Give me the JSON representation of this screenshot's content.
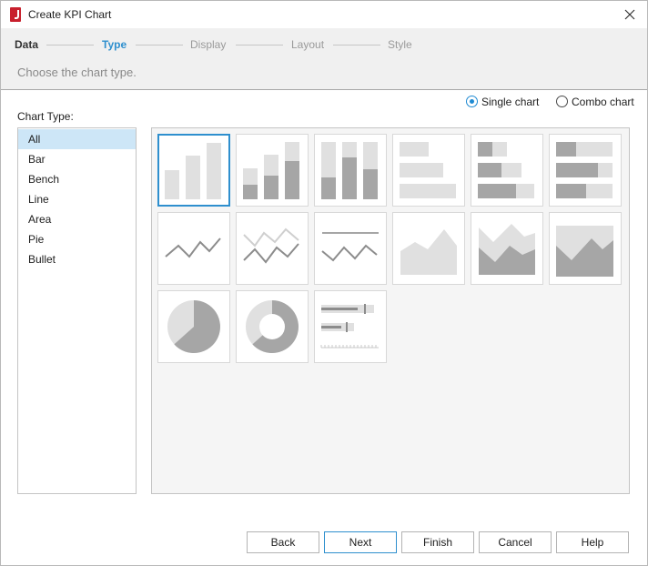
{
  "window": {
    "title": "Create KPI Chart",
    "close_icon": "close-icon"
  },
  "wizard": {
    "steps": [
      {
        "label": "Data",
        "state": "done"
      },
      {
        "label": "Type",
        "state": "active"
      },
      {
        "label": "Display",
        "state": "pending"
      },
      {
        "label": "Layout",
        "state": "pending"
      },
      {
        "label": "Style",
        "state": "pending"
      }
    ],
    "description": "Choose the chart type."
  },
  "mode": {
    "options": [
      "Single chart",
      "Combo chart"
    ],
    "selected": "Single chart"
  },
  "chart_types": {
    "label": "Chart Type:",
    "items": [
      "All",
      "Bar",
      "Bench",
      "Line",
      "Area",
      "Pie",
      "Bullet"
    ],
    "selected": "All"
  },
  "gallery": {
    "thumbnails": [
      {
        "icon": "bar-chart-icon",
        "selected": true
      },
      {
        "icon": "clustered-bar-chart-icon",
        "selected": false
      },
      {
        "icon": "stacked-bar-chart-icon",
        "selected": false
      },
      {
        "icon": "horizontal-bar-chart-icon",
        "selected": false
      },
      {
        "icon": "horizontal-bench-chart-icon",
        "selected": false
      },
      {
        "icon": "horizontal-stacked-bench-chart-icon",
        "selected": false
      },
      {
        "icon": "line-chart-icon",
        "selected": false
      },
      {
        "icon": "multi-line-chart-icon",
        "selected": false
      },
      {
        "icon": "line-with-target-chart-icon",
        "selected": false
      },
      {
        "icon": "area-chart-icon",
        "selected": false
      },
      {
        "icon": "overlapped-area-chart-icon",
        "selected": false
      },
      {
        "icon": "stacked-area-chart-icon",
        "selected": false
      },
      {
        "icon": "pie-chart-icon",
        "selected": false
      },
      {
        "icon": "donut-chart-icon",
        "selected": false
      },
      {
        "icon": "bullet-chart-icon",
        "selected": false
      }
    ]
  },
  "buttons": {
    "back": "Back",
    "next": "Next",
    "finish": "Finish",
    "cancel": "Cancel",
    "help": "Help"
  },
  "colors": {
    "accent": "#2e8fce",
    "selection": "#cde6f7",
    "thumb_dark": "#a6a6a6",
    "thumb_light": "#e0e0e0"
  }
}
